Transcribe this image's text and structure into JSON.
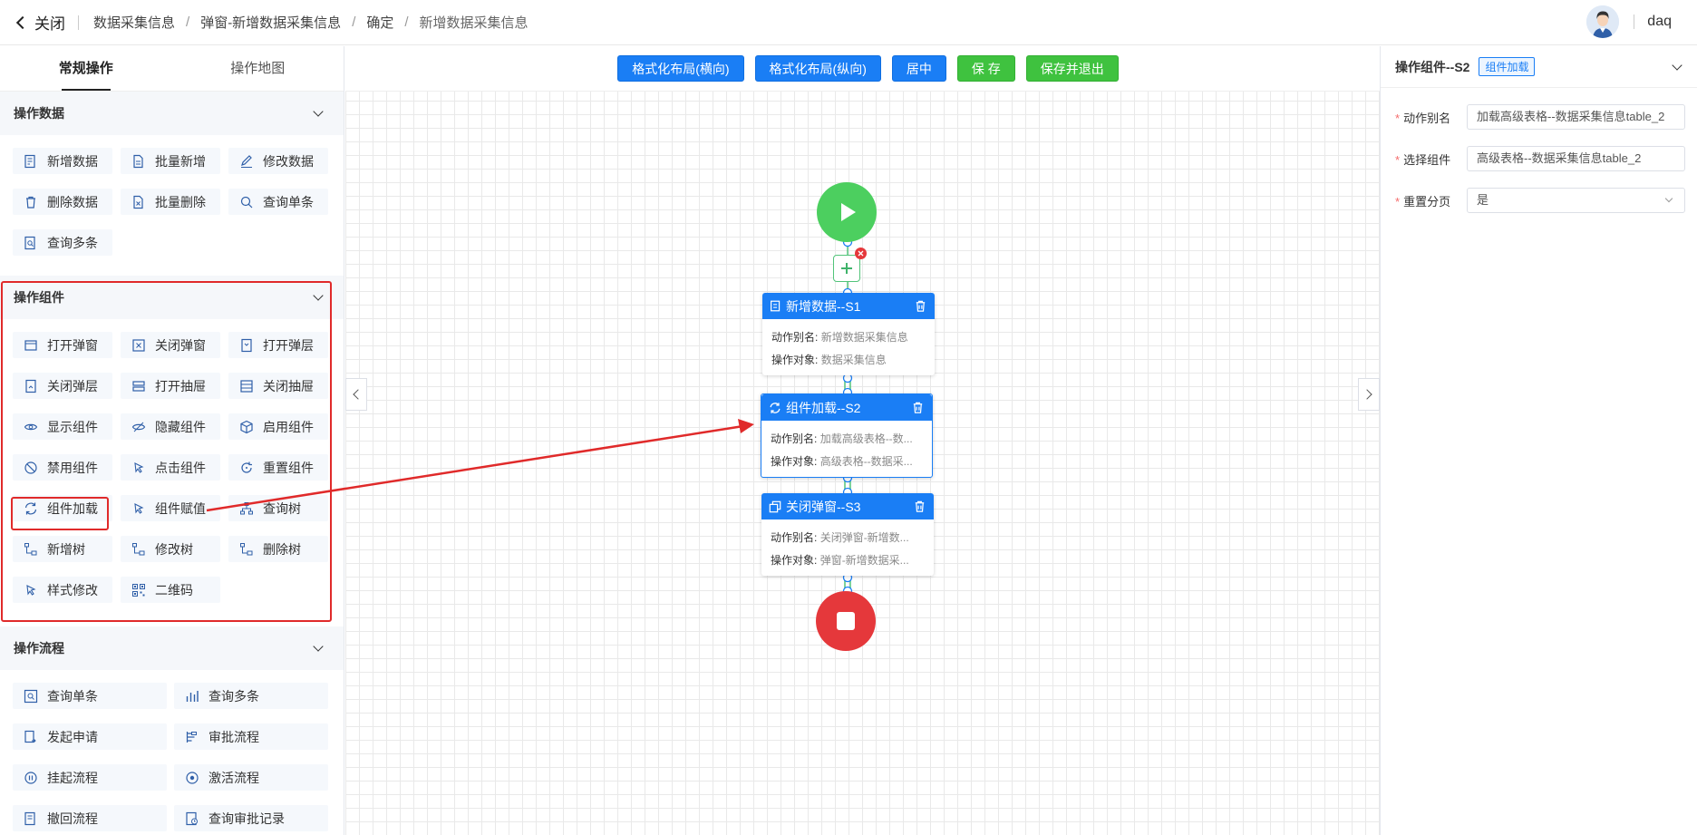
{
  "header": {
    "close_label": "关闭",
    "breadcrumb": [
      "数据采集信息",
      "弹窗-新增数据采集信息",
      "确定",
      "新增数据采集信息"
    ],
    "username": "daq"
  },
  "left": {
    "tabs": [
      "常规操作",
      "操作地图"
    ],
    "groups": [
      {
        "title": "操作数据",
        "items": [
          "新增数据",
          "批量新增",
          "修改数据",
          "删除数据",
          "批量删除",
          "查询单条",
          "查询多条"
        ]
      },
      {
        "title": "操作组件",
        "items": [
          "打开弹窗",
          "关闭弹窗",
          "打开弹层",
          "关闭弹层",
          "打开抽屉",
          "关闭抽屉",
          "显示组件",
          "隐藏组件",
          "启用组件",
          "禁用组件",
          "点击组件",
          "重置组件",
          "组件加载",
          "组件赋值",
          "查询树",
          "新增树",
          "修改树",
          "删除树",
          "样式修改",
          "二维码"
        ]
      },
      {
        "title": "操作流程",
        "items": [
          "查询单条",
          "查询多条",
          "发起申请",
          "审批流程",
          "挂起流程",
          "激活流程",
          "撤回流程",
          "查询审批记录"
        ]
      }
    ]
  },
  "toolbar": {
    "buttons": [
      "格式化布局(横向)",
      "格式化布局(纵向)",
      "居中",
      "保 存",
      "保存并退出"
    ]
  },
  "flow": {
    "nodes": [
      {
        "title": "新增数据--S1",
        "alias_label": "动作别名:",
        "alias": "新增数据采集信息",
        "target_label": "操作对象:",
        "target": "数据采集信息"
      },
      {
        "title": "组件加载--S2",
        "alias_label": "动作别名:",
        "alias": "加载高级表格--数...",
        "target_label": "操作对象:",
        "target": "高级表格--数据采..."
      },
      {
        "title": "关闭弹窗--S3",
        "alias_label": "动作别名:",
        "alias": "关闭弹窗-新增数...",
        "target_label": "操作对象:",
        "target": "弹窗-新增数据采..."
      }
    ]
  },
  "right": {
    "title": "操作组件--S2",
    "badge": "组件加载",
    "fields": [
      {
        "label": "动作别名",
        "value": "加载高级表格--数据采集信息table_2"
      },
      {
        "label": "选择组件",
        "value": "高级表格--数据采集信息table_2"
      },
      {
        "label": "重置分页",
        "value": "是"
      }
    ]
  },
  "colors": {
    "primary": "#1a7ef5",
    "success": "#3fc23f",
    "start": "#4ccf5f",
    "end": "#e5383b",
    "highlight": "#e02a2a"
  }
}
